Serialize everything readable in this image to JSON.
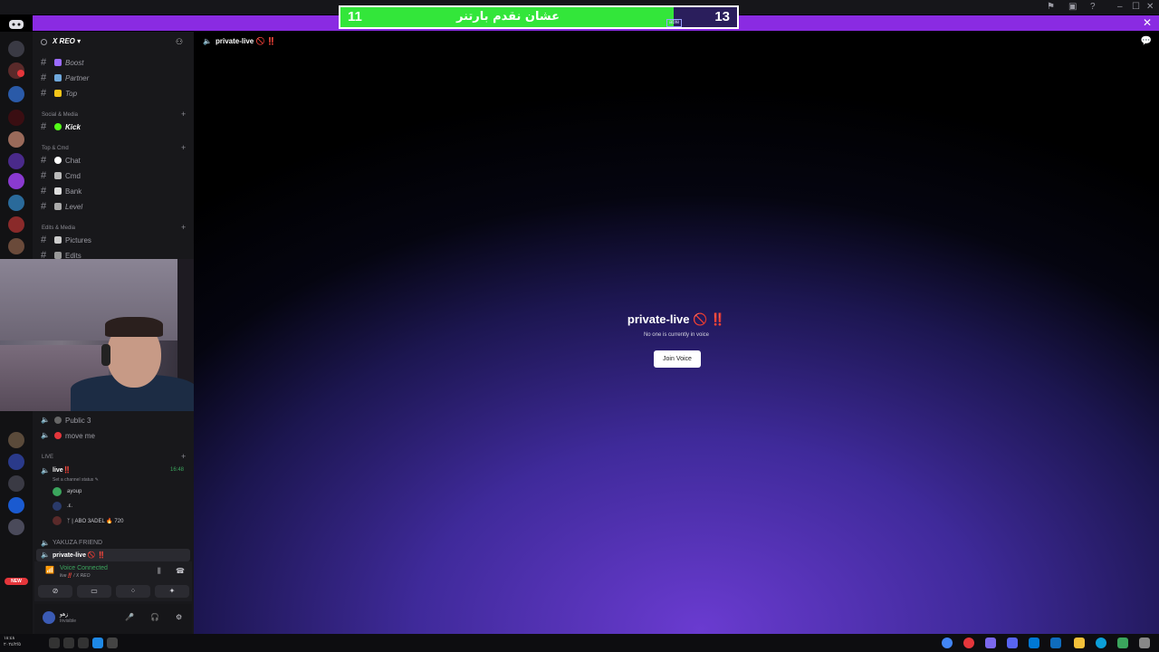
{
  "window": {
    "close_glyph": "✕",
    "controls": [
      "⚑",
      "▣",
      "?",
      "–",
      "☐",
      "✕"
    ]
  },
  "score_banner": {
    "left_score": "11",
    "right_score": "13",
    "title": "عشان نقدم بارتنر",
    "tag": "able",
    "fill_fraction": 0.84,
    "colors": {
      "fill": "#33e63a",
      "track": "#2a1e5c",
      "border": "#ffffff"
    }
  },
  "server": {
    "name": "X REO ▾"
  },
  "channels": [
    {
      "label": "Boost",
      "emoji_color": "#9b6bff"
    },
    {
      "label": "Partner",
      "emoji_color": "#6fa8dc"
    },
    {
      "label": "Top",
      "emoji_color": "#f5c518"
    }
  ],
  "categories": {
    "social": "Social & Media",
    "top_cmd": "Top & Cmd",
    "edits": "Edits & Media",
    "live": "LIVE"
  },
  "social_channels": [
    {
      "label": "Kick",
      "emoji_color": "#53fc18",
      "active": true
    }
  ],
  "cmd_channels": [
    {
      "label": "Chat",
      "emoji_color": "#ffffff"
    },
    {
      "label": "Cmd",
      "emoji_color": "#cccccc"
    },
    {
      "label": "Bank",
      "emoji_color": "#dddddd"
    },
    {
      "label": "Level",
      "emoji_color": "#aaaaaa"
    }
  ],
  "edit_channels": [
    {
      "label": "Pictures"
    },
    {
      "label": "Edits"
    }
  ],
  "voice_channels": [
    {
      "label": "Public 3",
      "icon": "headphones-icon"
    },
    {
      "label": "move me",
      "icon": "red-circle-icon"
    }
  ],
  "live_channel": {
    "name": "live‼️",
    "time": "16:48",
    "status": "Set a channel status ✎",
    "members": [
      "ayoup",
      ".ε.",
      "ᛉ | ABO 3ADEL 🔥 720"
    ]
  },
  "yakuza": "YAKUZA FRIEND",
  "active_voice": "private-live 🚫 ‼️",
  "voice_panel": {
    "title": "Voice Connected",
    "subtitle": "live‼️ / X REO"
  },
  "user": {
    "name": "زهو",
    "status": "Invisible"
  },
  "main": {
    "header": "private-live 🚫 ‼️",
    "title": "private-live 🚫 ‼️",
    "subtitle": "No one is currently in voice",
    "join_label": "Join Voice"
  },
  "taskbar": {
    "time": "١٨:٤٨\n٢٠٢٤/٢/٥"
  }
}
